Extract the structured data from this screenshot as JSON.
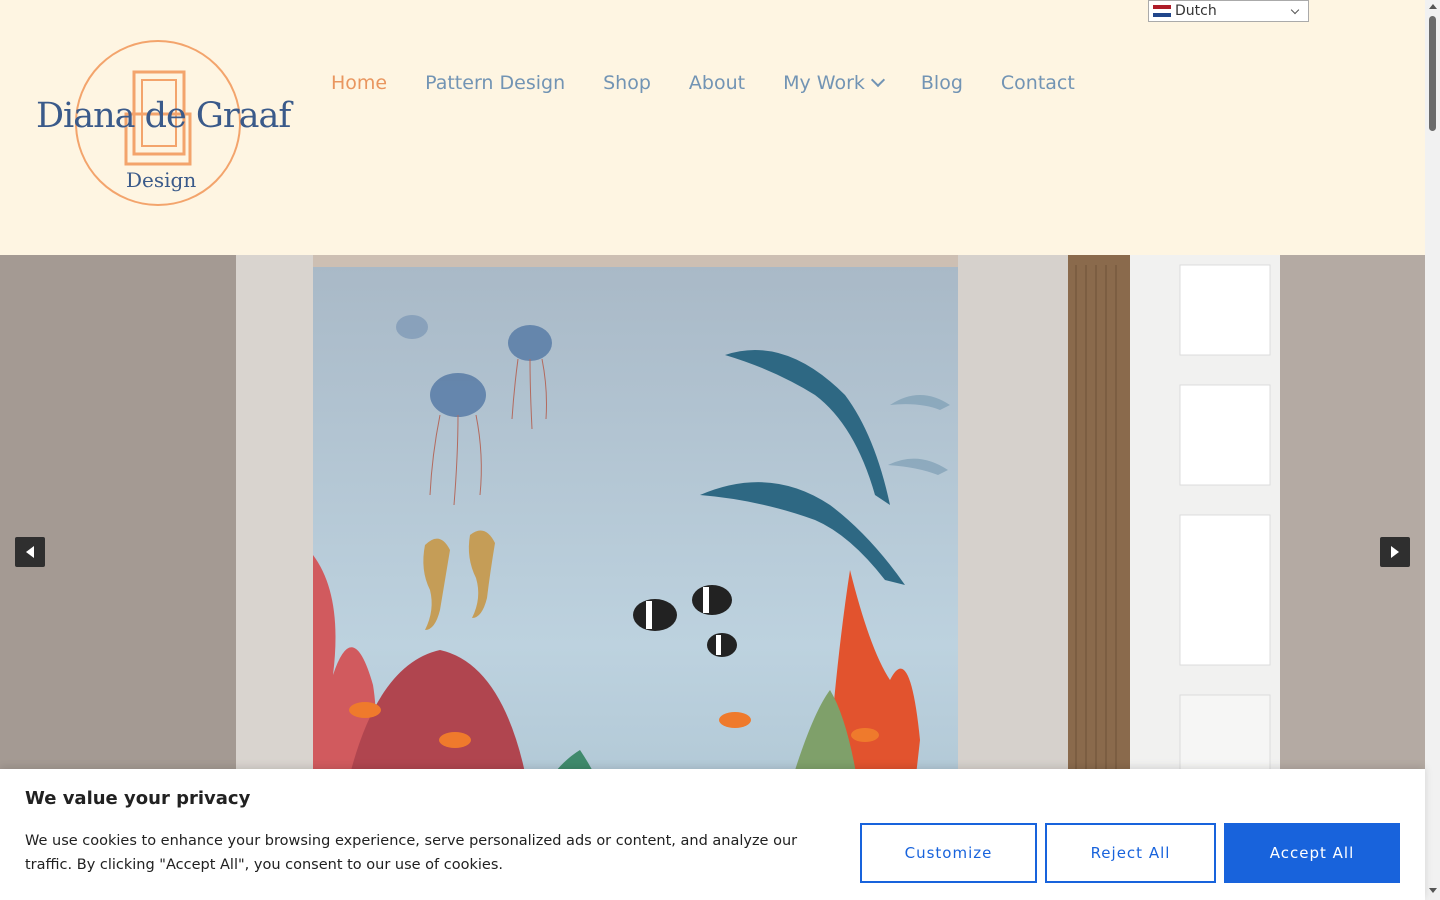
{
  "header": {
    "logo_text": "Diana de Graaf",
    "logo_sub": "Design",
    "nav": [
      {
        "label": "Home"
      },
      {
        "label": "Pattern Design"
      },
      {
        "label": "Shop"
      },
      {
        "label": "About"
      },
      {
        "label": "My Work"
      },
      {
        "label": "Blog"
      },
      {
        "label": "Contact"
      }
    ],
    "language_selected": "Dutch"
  },
  "colors": {
    "header_bg": "#fef5e2",
    "nav_text": "#7294b4",
    "nav_active": "#e9965f",
    "accent": "#1863dc"
  },
  "hero": {
    "prev_icon": "triangle-left-icon",
    "next_icon": "triangle-right-icon"
  },
  "cookie": {
    "title": "We value your privacy",
    "text": "We use cookies to enhance your browsing experience, serve personalized ads or content, and analyze our traffic. By clicking \"Accept All\", you consent to our use of cookies.",
    "customize_label": "Customize",
    "reject_label": "Reject All",
    "accept_label": "Accept All"
  }
}
